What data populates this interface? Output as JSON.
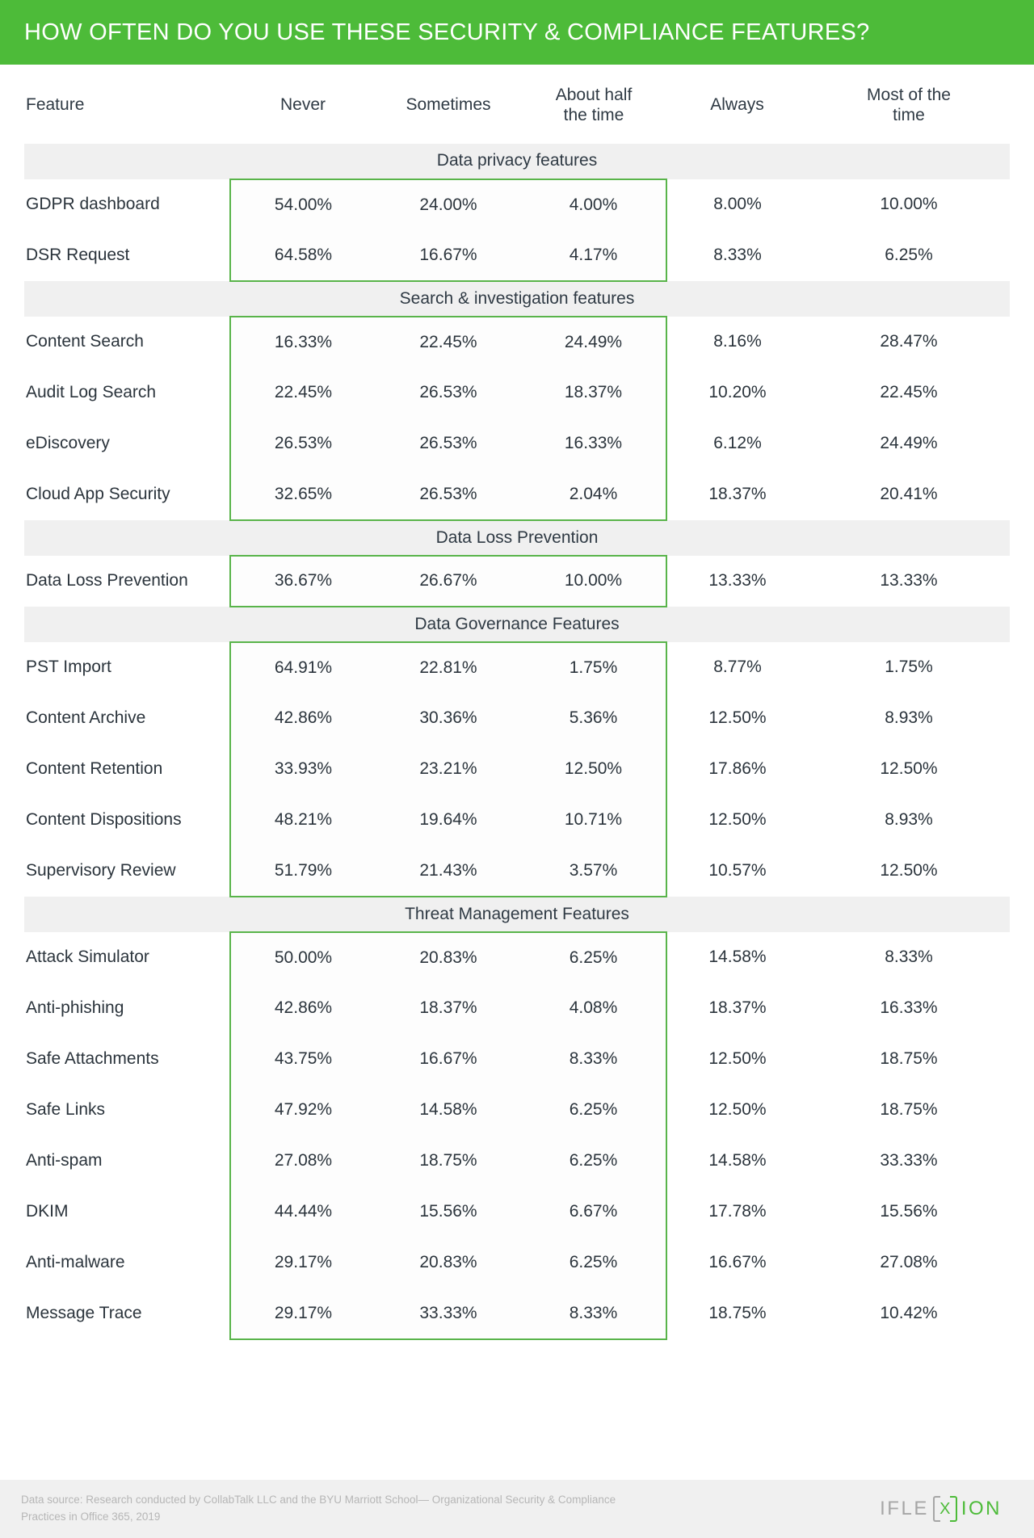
{
  "header": {
    "title": "HOW OFTEN DO YOU USE THESE SECURITY & COMPLIANCE FEATURES?",
    "bar_color": "#4DBB39"
  },
  "columns": [
    "Feature",
    "Never",
    "Sometimes",
    "About half\nthe time",
    "Always",
    "Most of the\ntime"
  ],
  "column_labels": {
    "feature": "Feature",
    "never": "Never",
    "sometimes": "Sometimes",
    "about_half_line1": "About half",
    "about_half_line2": "the time",
    "always": "Always",
    "most_line1": "Most of the",
    "most_line2": "time"
  },
  "highlight_color": "#59B44A",
  "section_bg": "#f0f0f0",
  "chart_data": {
    "type": "table",
    "title": "HOW OFTEN DO YOU USE THESE SECURITY & COMPLIANCE FEATURES?",
    "columns": [
      "Feature",
      "Never",
      "Sometimes",
      "About half the time",
      "Always",
      "Most of the time"
    ],
    "units": "percent",
    "sections": [
      {
        "name": "Data privacy features",
        "rows": [
          {
            "feature": "GDPR dashboard",
            "never": "54.00%",
            "sometimes": "24.00%",
            "about_half": "4.00%",
            "always": "8.00%",
            "most": "10.00%"
          },
          {
            "feature": "DSR Request",
            "never": "64.58%",
            "sometimes": "16.67%",
            "about_half": "4.17%",
            "always": "8.33%",
            "most": "6.25%"
          }
        ]
      },
      {
        "name": "Search & investigation features",
        "rows": [
          {
            "feature": "Content Search",
            "never": "16.33%",
            "sometimes": "22.45%",
            "about_half": "24.49%",
            "always": "8.16%",
            "most": "28.47%"
          },
          {
            "feature": "Audit Log Search",
            "never": "22.45%",
            "sometimes": "26.53%",
            "about_half": "18.37%",
            "always": "10.20%",
            "most": "22.45%"
          },
          {
            "feature": "eDiscovery",
            "never": "26.53%",
            "sometimes": "26.53%",
            "about_half": "16.33%",
            "always": "6.12%",
            "most": "24.49%"
          },
          {
            "feature": "Cloud App Security",
            "never": "32.65%",
            "sometimes": "26.53%",
            "about_half": "2.04%",
            "always": "18.37%",
            "most": "20.41%"
          }
        ]
      },
      {
        "name": "Data Loss Prevention",
        "rows": [
          {
            "feature": "Data Loss Prevention",
            "never": "36.67%",
            "sometimes": "26.67%",
            "about_half": "10.00%",
            "always": "13.33%",
            "most": "13.33%"
          }
        ]
      },
      {
        "name": "Data Governance Features",
        "rows": [
          {
            "feature": "PST Import",
            "never": "64.91%",
            "sometimes": "22.81%",
            "about_half": "1.75%",
            "always": "8.77%",
            "most": "1.75%"
          },
          {
            "feature": "Content Archive",
            "never": "42.86%",
            "sometimes": "30.36%",
            "about_half": "5.36%",
            "always": "12.50%",
            "most": "8.93%"
          },
          {
            "feature": "Content Retention",
            "never": "33.93%",
            "sometimes": "23.21%",
            "about_half": "12.50%",
            "always": "17.86%",
            "most": "12.50%"
          },
          {
            "feature": "Content Dispositions",
            "never": "48.21%",
            "sometimes": "19.64%",
            "about_half": "10.71%",
            "always": "12.50%",
            "most": "8.93%"
          },
          {
            "feature": "Supervisory Review",
            "never": "51.79%",
            "sometimes": "21.43%",
            "about_half": "3.57%",
            "always": "10.57%",
            "most": "12.50%"
          }
        ]
      },
      {
        "name": "Threat Management Features",
        "rows": [
          {
            "feature": "Attack Simulator",
            "never": "50.00%",
            "sometimes": "20.83%",
            "about_half": "6.25%",
            "always": "14.58%",
            "most": "8.33%"
          },
          {
            "feature": "Anti-phishing",
            "never": "42.86%",
            "sometimes": "18.37%",
            "about_half": "4.08%",
            "always": "18.37%",
            "most": "16.33%"
          },
          {
            "feature": "Safe Attachments",
            "never": "43.75%",
            "sometimes": "16.67%",
            "about_half": "8.33%",
            "always": "12.50%",
            "most": "18.75%"
          },
          {
            "feature": "Safe Links",
            "never": "47.92%",
            "sometimes": "14.58%",
            "about_half": "6.25%",
            "always": "12.50%",
            "most": "18.75%"
          },
          {
            "feature": "Anti-spam",
            "never": "27.08%",
            "sometimes": "18.75%",
            "about_half": "6.25%",
            "always": "14.58%",
            "most": "33.33%"
          },
          {
            "feature": "DKIM",
            "never": "44.44%",
            "sometimes": "15.56%",
            "about_half": "6.67%",
            "always": "17.78%",
            "most": "15.56%"
          },
          {
            "feature": "Anti-malware",
            "never": "29.17%",
            "sometimes": "20.83%",
            "about_half": "6.25%",
            "always": "16.67%",
            "most": "27.08%"
          },
          {
            "feature": "Message Trace",
            "never": "29.17%",
            "sometimes": "33.33%",
            "about_half": "8.33%",
            "always": "18.75%",
            "most": "10.42%"
          }
        ]
      }
    ]
  },
  "footer": {
    "note_line1": "Data source: Research conducted by CollabTalk LLC and the BYU Marriott School— Organizational Security & Compliance",
    "note_line2": "Practices in Office 365, 2019",
    "logo_left": "IFLE",
    "logo_mark": "X",
    "logo_right": "ION"
  }
}
